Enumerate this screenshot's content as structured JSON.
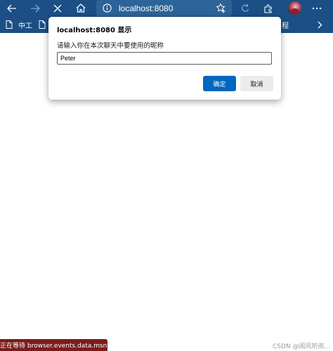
{
  "browser": {
    "address": "localhost:8080",
    "icons": [
      "back-icon",
      "forward-icon",
      "close-icon",
      "home-icon",
      "info-icon",
      "favorite-icon",
      "refresh-icon",
      "extensions-icon",
      "avatar",
      "menu-icon"
    ]
  },
  "bookmarks": {
    "items": [
      {
        "label": "中工"
      },
      {
        "label": ""
      },
      {
        "label": "程"
      }
    ]
  },
  "dialog": {
    "title": "localhost:8080 显示",
    "message": "请输入你在本次聊天中要使用的昵称",
    "input_value": "Peter",
    "ok_label": "确定",
    "cancel_label": "取消"
  },
  "status": {
    "text": "正在等待 browser.events.data.msn.c..."
  },
  "watermark": {
    "text": "CSDN @阅风听雨..."
  },
  "colors": {
    "toolbar_bg": "#1b4f86",
    "addressbar_bg": "#2c6497",
    "primary_button": "#0067c0",
    "status_bg": "#7a1c1c"
  }
}
